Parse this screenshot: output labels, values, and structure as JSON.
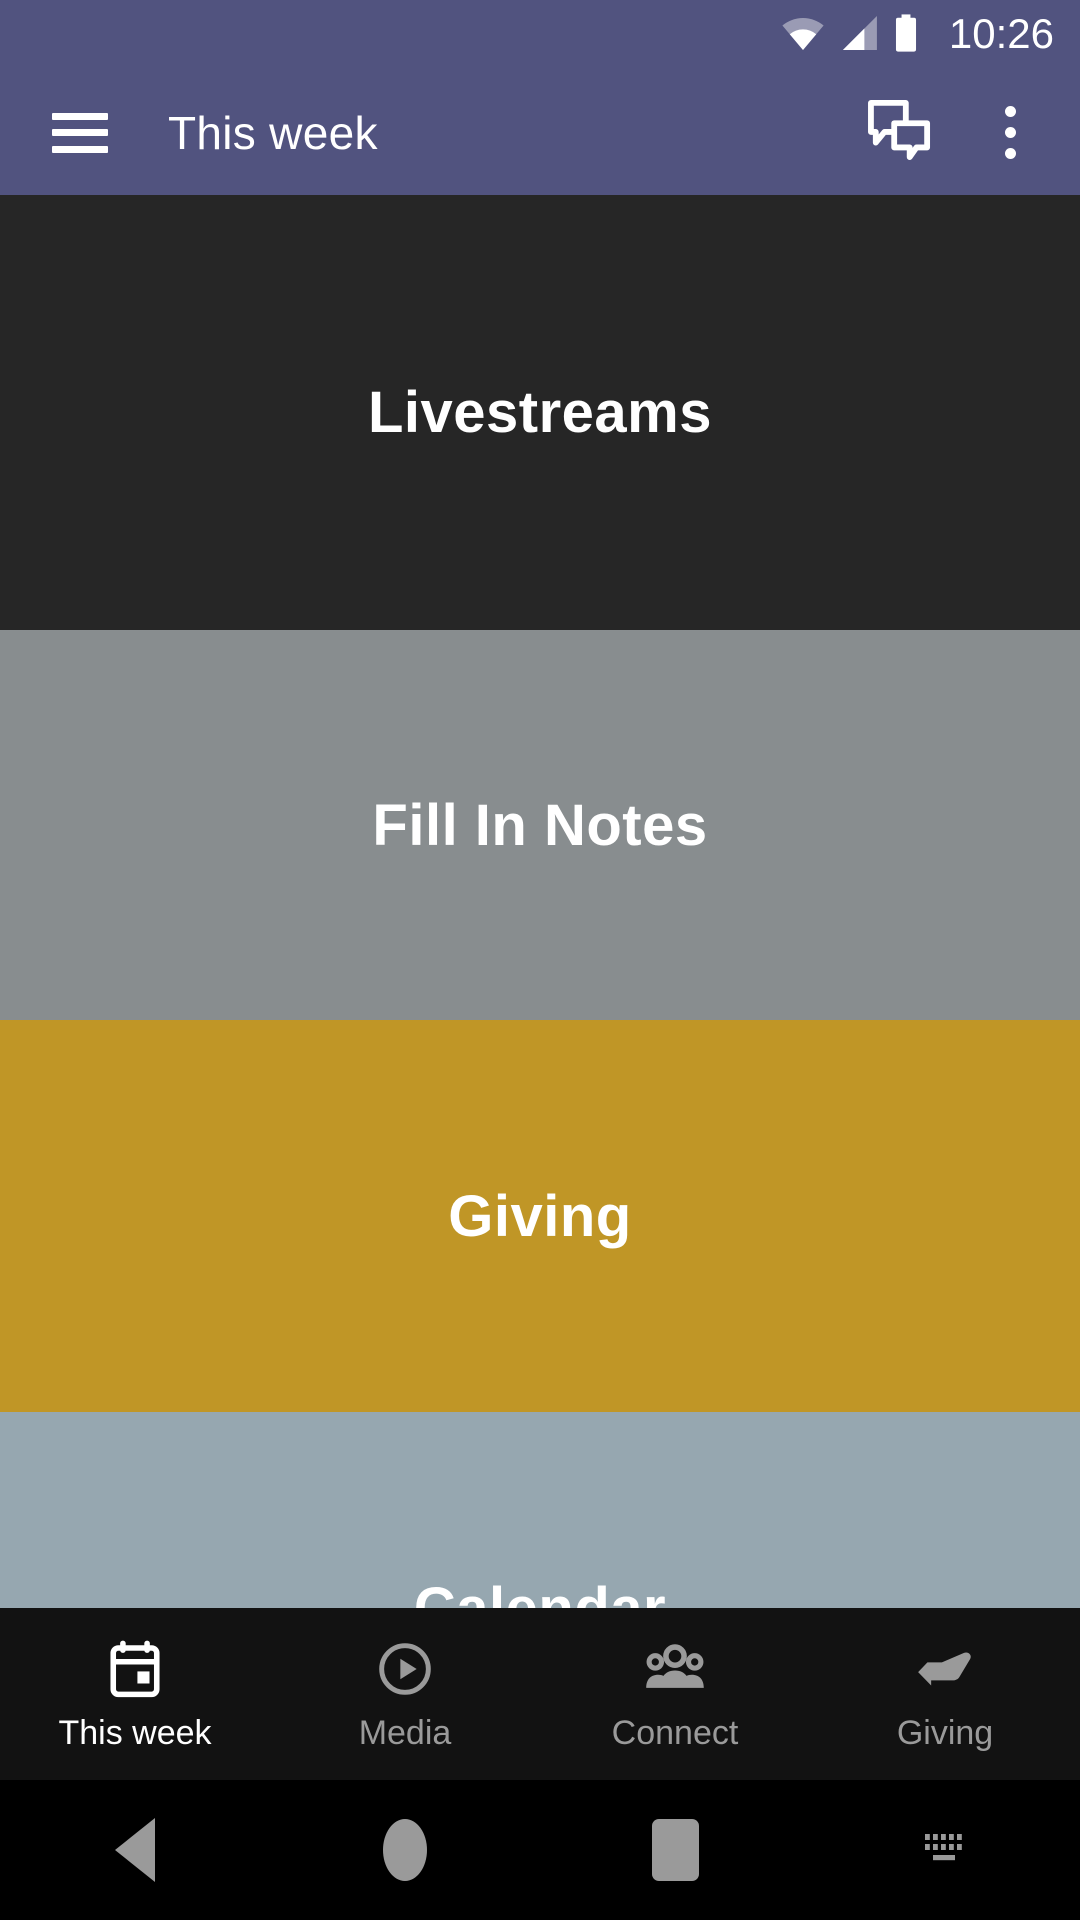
{
  "status_bar": {
    "time": "10:26",
    "icons": [
      "wifi-icon",
      "cell-signal-icon",
      "battery-icon"
    ]
  },
  "app_bar": {
    "menu_icon": "hamburger-menu-icon",
    "title": "This week",
    "actions": [
      {
        "icon": "chat-bubbles-icon",
        "label": "Messages"
      },
      {
        "icon": "overflow-menu-icon",
        "label": "More options"
      }
    ]
  },
  "content": {
    "panels": [
      {
        "label": "Livestreams",
        "color": "#262626"
      },
      {
        "label": "Fill In Notes",
        "color": "#888D8F"
      },
      {
        "label": "Giving",
        "color": "#C09626"
      },
      {
        "label": "Calendar",
        "color": "#96A7B0"
      }
    ]
  },
  "bottom_nav": {
    "items": [
      {
        "label": "This week",
        "icon": "calendar-icon",
        "active": true
      },
      {
        "label": "Media",
        "icon": "play-circle-icon",
        "active": false
      },
      {
        "label": "Connect",
        "icon": "people-group-icon",
        "active": false
      },
      {
        "label": "Giving",
        "icon": "giving-hand-icon",
        "active": false
      }
    ]
  },
  "system_nav": {
    "buttons": [
      {
        "label": "Back",
        "icon": "back-triangle-icon"
      },
      {
        "label": "Home",
        "icon": "home-circle-icon"
      },
      {
        "label": "Recents",
        "icon": "recents-square-icon"
      },
      {
        "label": "Keyboard",
        "icon": "keyboard-icon"
      }
    ]
  },
  "colors": {
    "app_bar": "#51537F",
    "nav_background": "#121212",
    "active_text": "#FFFFFF",
    "inactive_text": "#9A9A9A"
  }
}
